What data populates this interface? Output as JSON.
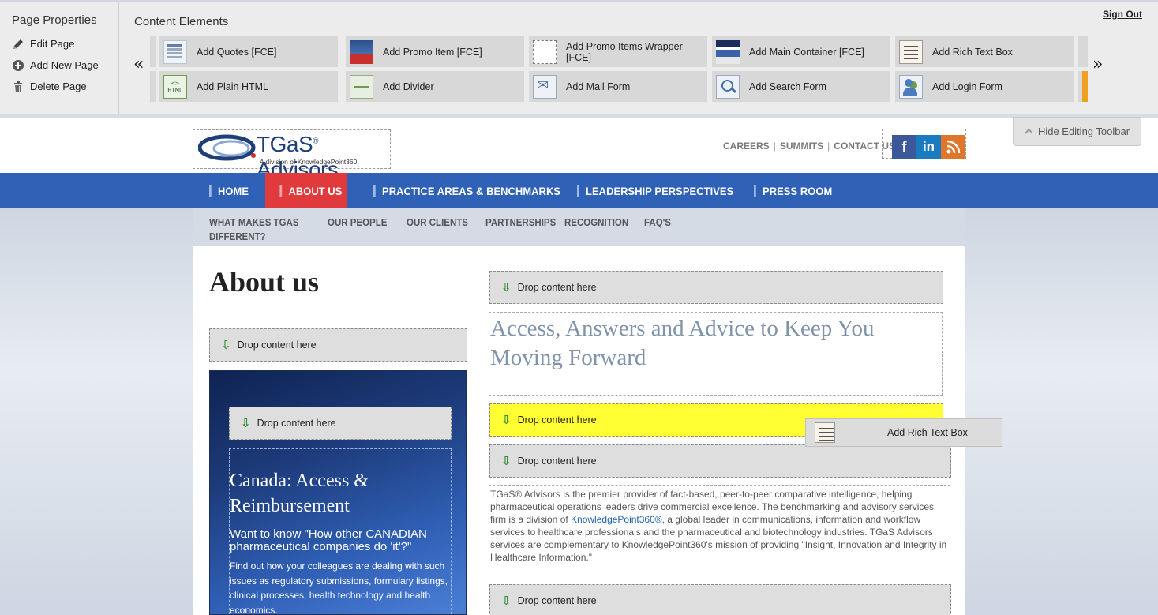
{
  "page_properties": {
    "title": "Page Properties",
    "items": [
      {
        "label": "Edit Page",
        "icon": "pencil-icon"
      },
      {
        "label": "Add New Page",
        "icon": "plus-circle-icon"
      },
      {
        "label": "Delete Page",
        "icon": "trash-icon"
      }
    ]
  },
  "content_elements": {
    "title": "Content Elements",
    "prev": "«",
    "next": "»",
    "row1": [
      "Add Quotes [FCE]",
      "Add Promo Item [FCE]",
      "Add Promo Items Wrapper [FCE]",
      "Add Main Container [FCE]",
      "Add Rich Text Box"
    ],
    "row2": [
      "Add Plain HTML",
      "Add Divider",
      "Add Mail Form",
      "Add Search Form",
      "Add Login Form"
    ],
    "html_thumb": "<>",
    "html_thumb_label": "HTML"
  },
  "sign_out": "Sign Out",
  "hide_toolbar": "Hide Editing Toolbar",
  "logo": {
    "brand": "TGaS",
    "brand_mark": "®",
    "brand_rest": " Advisors",
    "tagline": "A division of KnowledgePoint360"
  },
  "util_nav": [
    "CAREERS",
    "SUMMITS",
    "CONTACT US"
  ],
  "social": {
    "facebook": "f",
    "linkedin": "in",
    "rss": "rss-icon"
  },
  "main_nav": [
    "HOME",
    "ABOUT US",
    "PRACTICE AREAS & BENCHMARKS",
    "LEADERSHIP PERSPECTIVES",
    "PRESS ROOM"
  ],
  "main_nav_active": "ABOUT US",
  "sub_nav": [
    "WHAT MAKES TGAS DIFFERENT?",
    "OUR PEOPLE",
    "OUR CLIENTS",
    "PARTNERSHIPS",
    "RECOGNITION",
    "FAQ'S"
  ],
  "page_title": "About us",
  "drop_label": "Drop content here",
  "promo": {
    "title": "Canada: Access & Reimbursement",
    "subtitle": "Want to know \"How other CANADIAN pharmaceutical companies do 'it'?\"",
    "body": "Find out how your colleagues are dealing with such issues as regulatory submissions, formulary listings, clinical processes, health technology and health economics."
  },
  "headline": "Access, Answers and Advice to Keep You Moving Forward",
  "body": {
    "part1": "TGaS® Advisors is the premier provider of fact-based, peer-to-peer comparative intelligence, helping pharmaceutical operations leaders drive commercial excellence. The benchmarking and advisory services firm is a division of ",
    "link": "KnowledgePoint360®",
    "part2": ", a global leader in communications, information and workflow services to healthcare professionals and the pharmaceutical and biotechnology industries. TGaS Advisors services are complementary to KnowledgePoint360's mission of providing \"Insight, Innovation and Integrity in Healthcare Information.\""
  },
  "drag_ghost": "Add Rich Text Box",
  "colors": {
    "nav_blue": "#2f62b6",
    "nav_active_red": "#e03a3c",
    "drop_highlight": "#ffff33",
    "headline_gray_blue": "#7f93aa"
  }
}
